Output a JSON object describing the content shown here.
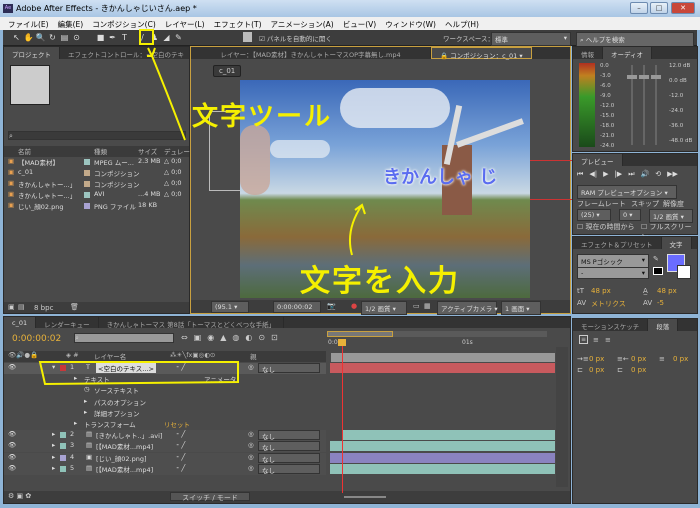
{
  "window": {
    "title": "Adobe After Effects - きかんしゃじいさん.aep *",
    "icon_text": "Ae",
    "controls": [
      "–",
      "□",
      "✕"
    ]
  },
  "menu": [
    "ファイル(E)",
    "編集(E)",
    "コンポジション(C)",
    "レイヤー(L)",
    "エフェクト(T)",
    "アニメーション(A)",
    "ビュー(V)",
    "ウィンドウ(W)",
    "ヘルプ(H)"
  ],
  "toolbar": {
    "tools": [
      "selection-tool",
      "hand-tool",
      "zoom-tool",
      "rotate-tool",
      "camera-tool",
      "pan-behind-tool",
      "rectangle-tool",
      "pen-tool",
      "type-tool",
      "brush-tool",
      "clone-stamp-tool",
      "eraser-tool",
      "puppet-tool"
    ],
    "tool_glyphs": [
      "↖",
      "✋",
      "🔍",
      "↻",
      "▤",
      "⊙",
      "■",
      "✒",
      "T",
      "/",
      "♟",
      "◢",
      "✎"
    ],
    "auto_open_label": "パネルを自動的に開く",
    "workspace_label": "ワークスペース：",
    "workspace_value": "標準",
    "help_placeholder": "ヘルプを検索"
  },
  "project": {
    "tabs": [
      "プロジェクト",
      "エフェクトコントロール：<空白のテキ"
    ],
    "columns": [
      "名前",
      "種類",
      "サイズ",
      "デュレーション"
    ],
    "items": [
      {
        "name": "【MAD素材】",
        "type": "MPEG ムー...",
        "size": "2.3 MB",
        "dur": "△ 0;0",
        "color": "#9cc5c0"
      },
      {
        "name": "c_01",
        "type": "コンポジション",
        "size": "",
        "dur": "△ 0;0",
        "color": "#c2a98a"
      },
      {
        "name": "きかんしゃトー...」",
        "type": "コンポジション",
        "size": "",
        "dur": "△ 0;0",
        "color": "#c2a98a"
      },
      {
        "name": "きかんしゃトー...」",
        "type": "AVI",
        "size": "...4 MB",
        "dur": "△ 0;0",
        "color": "#9cc5c0"
      },
      {
        "name": "じい_顔02.png",
        "type": "PNG ファイル",
        "size": "18 KB",
        "dur": "",
        "color": "#a8a2d2"
      }
    ],
    "bpc": "8 bpc"
  },
  "viewer": {
    "tabs": [
      "レイヤー：【MAD素材】きかんしゃトーマスOP字幕無し.mp4",
      "コンポジション：c_01"
    ],
    "comp_label": "c_01",
    "overlay_text": "きかんしゃ じ",
    "text_color": "#5a6cf0",
    "controls": {
      "zoom": "(95.1",
      "timecode": "0:00:00:02",
      "resolution": "1/2 画質",
      "camera": "アクティブカメラ",
      "views": "1 画面"
    }
  },
  "audio": {
    "tabs": [
      "情報",
      "オーディオ"
    ],
    "left_scale": [
      "0.0",
      "-3.0",
      "-6.0",
      "-9.0",
      "-12.0",
      "-15.0",
      "-18.0",
      "-21.0",
      "-24.0"
    ],
    "right_scale": [
      "12.0 dB",
      "0.0 dB",
      "-12.0",
      "-24.0",
      "-36.0",
      "-48.0 dB"
    ]
  },
  "preview": {
    "tab": "プレビュー",
    "ram_option": "RAM プレビューオプション",
    "framerate_label": "フレームレート",
    "skip_label": "スキップ",
    "resolution_label": "解像度",
    "framerate": "(25)",
    "skip": "0",
    "resolution": "1/2 画質",
    "from_current": "現在の時間から",
    "fullscreen": "フルスクリーン",
    "buttons": [
      "⏮",
      "◀|",
      "▶",
      "|▶",
      "⏭",
      "🔊",
      "⟲",
      "▶▶"
    ]
  },
  "character": {
    "tabs": [
      "エフェクト＆プリセット",
      "文字"
    ],
    "font": "MS Pゴシック",
    "style": "-",
    "fill_color": "#6a6cff",
    "size": "48 px",
    "leading": "48 px",
    "kerning": "メトリクス",
    "tracking": "-5"
  },
  "paragraph": {
    "tabs": [
      "モーションスケッチ",
      "段落"
    ],
    "values": [
      "0 px",
      "0 px",
      "0 px",
      "0 px",
      "0 px"
    ]
  },
  "timeline": {
    "tabs": [
      "c_01",
      "レンダーキュー",
      "きかんしゃトーマス 第8話「トーマスとどくべつな手紙」"
    ],
    "timecode": "0:00:00:02",
    "search_placeholder": "",
    "col_layer": "レイヤー名",
    "col_parent": "親",
    "ruler": [
      "0:00s",
      "01s"
    ],
    "layers": [
      {
        "num": "1",
        "name": "<空白のテキス...>",
        "icon": "T",
        "color": "#c8383a",
        "parent": "なし",
        "bar": "#c85a5e"
      },
      {
        "num": "2",
        "name": "[きかんしゃト..」.avi]",
        "icon": "▤",
        "color": "#8fc2b8",
        "parent": "なし",
        "bar": "#8fc2b8"
      },
      {
        "num": "3",
        "name": "[【MAD素材...mp4]",
        "icon": "▤",
        "color": "#8fc2b8",
        "parent": "なし",
        "bar": "#8fc2b8"
      },
      {
        "num": "4",
        "name": "[じい_顔02.png]",
        "icon": "▣",
        "color": "#a8a2d2",
        "parent": "なし",
        "bar": "#8a83c0"
      },
      {
        "num": "5",
        "name": "[【MAD素材...mp4]",
        "icon": "▤",
        "color": "#8fc2b8",
        "parent": "なし",
        "bar": "#8fc2b8"
      }
    ],
    "props": {
      "text": "テキスト",
      "animator": "アニメータ：",
      "source": "ソーステキスト",
      "path": "パスのオプション",
      "more": "詳細オプション",
      "transform": "トランスフォーム",
      "reset": "リセット"
    },
    "switch_mode": "スイッチ / モード"
  },
  "annotations": {
    "type_tool": "文字ツール",
    "enter_text": "文字を入力",
    "color": "#f5f000"
  }
}
